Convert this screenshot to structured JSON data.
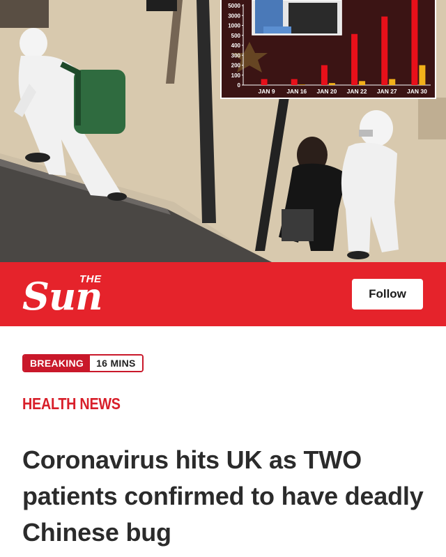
{
  "masthead": {
    "logo_the": "THE",
    "logo_sun": "Sun",
    "follow_label": "Follow",
    "brand_color": "#e5232b"
  },
  "article": {
    "badge_label": "BREAKING",
    "badge_time": "16 MINS",
    "section": "HEALTH NEWS",
    "headline": "Coronavirus hits UK as TWO patients confirmed to have deadly Chinese bug"
  },
  "chart_data": {
    "type": "bar",
    "title": "",
    "y_ticks": [
      "5000",
      "3000",
      "1000",
      "500",
      "400",
      "300",
      "200",
      "100",
      "0"
    ],
    "categories": [
      "JAN 9",
      "JAN 16",
      "JAN 20",
      "JAN 22",
      "JAN 27",
      "JAN 30"
    ],
    "series": [
      {
        "color": "#e8101a",
        "values": [
          60,
          60,
          200,
          570,
          2800,
          7700
        ]
      },
      {
        "color": "#f2b11a",
        "values": [
          0,
          5,
          20,
          40,
          60,
          200
        ]
      }
    ],
    "y_scale": "non-linear (ticks 0,100,200,300,400,500,1000,3000,5000)",
    "grid": false
  }
}
